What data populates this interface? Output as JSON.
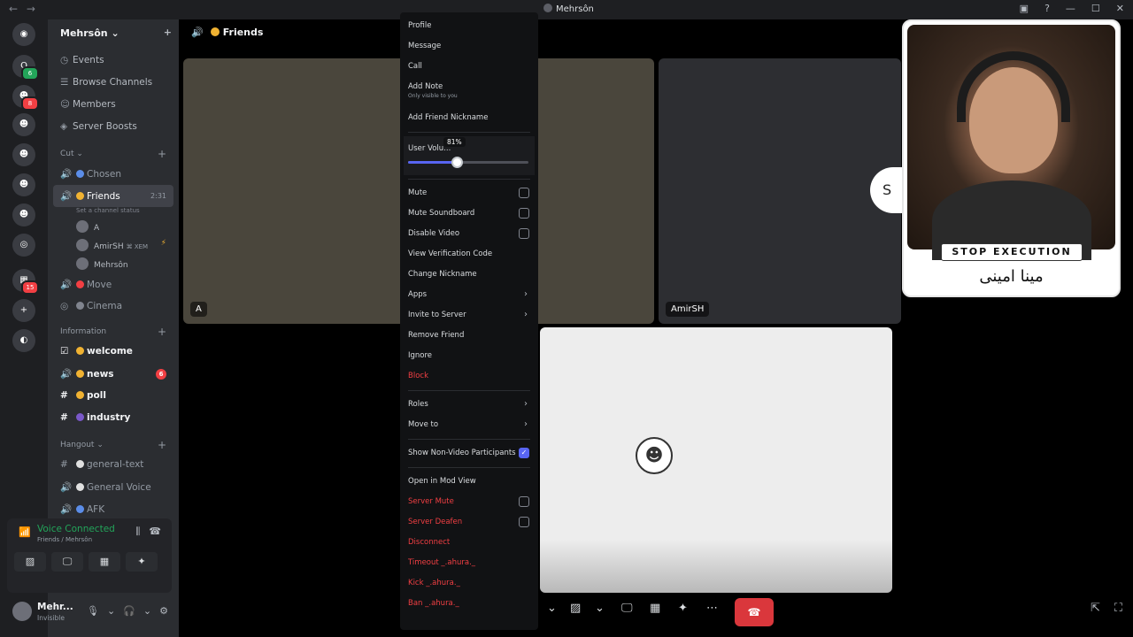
{
  "titlebar": {
    "back": "←",
    "forward": "→",
    "title": "Mehrsôn",
    "icons": [
      "inbox-icon",
      "help-icon",
      "minimize-icon",
      "maximize-icon",
      "close-icon"
    ],
    "glyphs": [
      "▣",
      "?",
      "—",
      "☐",
      "✕"
    ]
  },
  "servers": [
    {
      "label": "◉",
      "badge": "",
      "name": "discord-home"
    },
    {
      "label": "Q",
      "badge": "6",
      "name": "server-1",
      "green": true
    },
    {
      "label": "☻",
      "badge": "8",
      "name": "server-2"
    },
    {
      "label": "☻",
      "badge": "",
      "name": "server-3"
    },
    {
      "label": "☻",
      "badge": "",
      "name": "server-4"
    },
    {
      "label": "☻",
      "badge": "",
      "name": "server-5"
    },
    {
      "label": "☻",
      "badge": "",
      "name": "server-6"
    },
    {
      "label": "◎",
      "badge": "",
      "name": "server-7"
    },
    {
      "label": "▦",
      "badge": "15",
      "name": "server-folder"
    },
    {
      "label": "+",
      "badge": "",
      "name": "add-server"
    },
    {
      "label": "◐",
      "badge": "",
      "name": "discover"
    }
  ],
  "sidebar": {
    "server_name": "Mehrsôn",
    "server_chev": "⌄",
    "add_icon": "+",
    "nav": [
      {
        "icon": "◷",
        "label": "Events"
      },
      {
        "icon": "☰",
        "label": "Browse Channels"
      },
      {
        "icon": "☺",
        "label": "Members"
      },
      {
        "icon": "◈",
        "label": "Server Boosts"
      }
    ],
    "cat_cut": "Cut",
    "cat_information": "Information",
    "cat_hangout": "Hangout",
    "chevron": "⌄",
    "plus": "+",
    "channels_cut": [
      {
        "icon": "🔊",
        "dot": "#5b8de8",
        "label": "Chosen"
      }
    ],
    "active_channel": {
      "icon": "🔊",
      "dot": "#f0b232",
      "label": "Friends",
      "time": "2:31",
      "status": "Set a channel status"
    },
    "voice_users": [
      {
        "name": "A",
        "tag": "",
        "bolt": ""
      },
      {
        "name": "AmirSH",
        "tag": "⌘ XEM",
        "bolt": "⚡"
      },
      {
        "name": "Mehrsôn",
        "tag": "",
        "bolt": ""
      }
    ],
    "channels_cut2": [
      {
        "icon": "🔊",
        "dot": "#f23f43",
        "label": "Move"
      },
      {
        "icon": "◎",
        "dot": "#80848e",
        "label": "Cinema"
      }
    ],
    "channels_info": [
      {
        "icon": "☑",
        "dot": "#f0b232",
        "label": "welcome",
        "badge": ""
      },
      {
        "icon": "🔊",
        "dot": "#f0b232",
        "label": "news",
        "badge": "6"
      },
      {
        "icon": "#",
        "dot": "#f0b232",
        "label": "poll",
        "badge": ""
      },
      {
        "icon": "#",
        "dot": "#7a58c9",
        "label": "industry",
        "badge": ""
      }
    ],
    "channels_hangout": [
      {
        "icon": "#",
        "dot": "#e0e0e0",
        "label": "general-text"
      },
      {
        "icon": "🔊",
        "dot": "#e0e0e0",
        "label": "General Voice"
      },
      {
        "icon": "🔊",
        "dot": "#5b8de8",
        "label": "AFK"
      }
    ]
  },
  "voice_panel": {
    "title": "Voice Connected",
    "sub": "Friends / Mehrsôn",
    "signal": "📶",
    "right": [
      "⫼",
      "☎"
    ],
    "buttons": [
      "▨",
      "🖵",
      "▦",
      "✦"
    ]
  },
  "user": {
    "name": "Mehr...",
    "status": "Invisible",
    "controls": [
      "🎙",
      "⌄",
      "🎧",
      "⌄",
      "⚙"
    ]
  },
  "stage": {
    "channel": "Friends",
    "tiles": {
      "a": "A",
      "b": "AmirSH"
    }
  },
  "callbar": {
    "items": [
      "⌄",
      "▨",
      "⌄",
      "🖵",
      "▦",
      "✦",
      "⋯"
    ],
    "end": "☎",
    "corner": [
      "⇱",
      "⛶"
    ]
  },
  "webcam": {
    "banner": "STOP EXECUTION",
    "name": "مینا امینی",
    "logo": "S"
  },
  "menu": {
    "profile": "Profile",
    "message": "Message",
    "call": "Call",
    "add_note": "Add Note",
    "note_sub": "Only visible to you",
    "add_nickname": "Add Friend Nickname",
    "user_volume": "User Volu...",
    "volume_value": 81,
    "volume_label": "81%",
    "mute": "Mute",
    "mute_soundboard": "Mute Soundboard",
    "disable_video": "Disable Video",
    "view_verification": "View Verification Code",
    "change_nickname": "Change Nickname",
    "apps": "Apps",
    "invite": "Invite to Server",
    "remove_friend": "Remove Friend",
    "ignore": "Ignore",
    "block": "Block",
    "roles": "Roles",
    "move_to": "Move to",
    "show_nonvideo": "Show Non-Video Participants",
    "check": "✓",
    "arrow": "›",
    "open_mod": "Open in Mod View",
    "server_mute": "Server Mute",
    "server_deafen": "Server Deafen",
    "disconnect": "Disconnect",
    "timeout": "Timeout _.ahura._",
    "kick": "Kick _.ahura._",
    "ban": "Ban _.ahura._"
  }
}
